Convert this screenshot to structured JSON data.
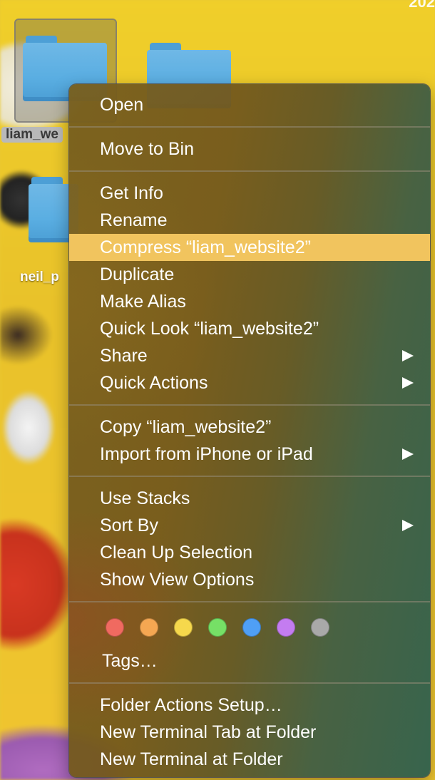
{
  "desktop": {
    "year_fragment": "202",
    "icons": [
      {
        "label": "liam_we",
        "selected": true
      },
      {
        "label": "neil_p",
        "selected": false
      }
    ]
  },
  "menu": {
    "sections": [
      {
        "items": [
          {
            "label": "Open"
          }
        ]
      },
      {
        "items": [
          {
            "label": "Move to Bin"
          }
        ]
      },
      {
        "items": [
          {
            "label": "Get Info"
          },
          {
            "label": "Rename"
          },
          {
            "label": "Compress “liam_website2”",
            "highlighted": true
          },
          {
            "label": "Duplicate"
          },
          {
            "label": "Make Alias"
          },
          {
            "label": "Quick Look “liam_website2”"
          },
          {
            "label": "Share",
            "submenu": true
          },
          {
            "label": "Quick Actions",
            "submenu": true
          }
        ]
      },
      {
        "items": [
          {
            "label": "Copy “liam_website2”"
          },
          {
            "label": "Import from iPhone or iPad",
            "submenu": true
          }
        ]
      },
      {
        "items": [
          {
            "label": "Use Stacks"
          },
          {
            "label": "Sort By",
            "submenu": true
          },
          {
            "label": "Clean Up Selection"
          },
          {
            "label": "Show View Options"
          }
        ]
      },
      {
        "tags": {
          "colors": [
            "#f06a60",
            "#f5a752",
            "#f6d84c",
            "#76e066",
            "#4f9ff5",
            "#c47cf0",
            "#a9a9a9"
          ],
          "label": "Tags…"
        }
      },
      {
        "items": [
          {
            "label": "Folder Actions Setup…"
          },
          {
            "label": "New Terminal Tab at Folder"
          },
          {
            "label": "New Terminal at Folder"
          }
        ]
      }
    ]
  }
}
